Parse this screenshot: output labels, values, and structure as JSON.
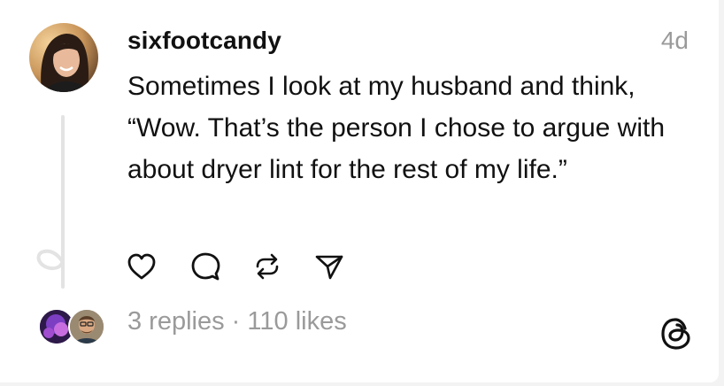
{
  "post": {
    "username": "sixfootcandy",
    "time_ago": "4d",
    "text": "Sometimes I look at my husband and think, “Wow. That’s the person I chose to argue with about dryer lint for the rest of my life.”"
  },
  "actions": [
    {
      "name": "like",
      "icon": "heart-icon"
    },
    {
      "name": "reply",
      "icon": "comment-bubble-icon"
    },
    {
      "name": "repost",
      "icon": "repost-icon"
    },
    {
      "name": "share",
      "icon": "send-icon"
    }
  ],
  "footer": {
    "replies": "3 replies",
    "separator": " · ",
    "likes": "110 likes"
  },
  "colors": {
    "text": "#111111",
    "muted": "#9a9a9a",
    "thread_line": "#e3e3e3"
  }
}
